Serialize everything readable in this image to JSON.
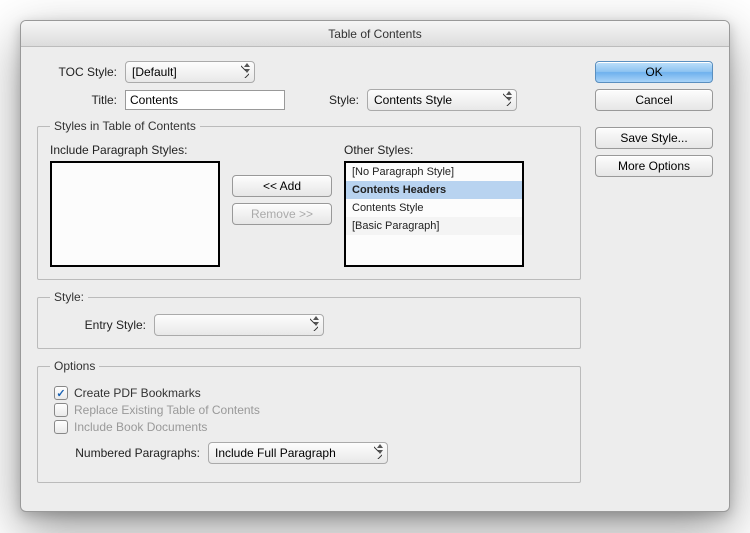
{
  "titlebar": "Table of Contents",
  "labels": {
    "toc_style": "TOC Style:",
    "title": "Title:",
    "style": "Style:",
    "include_ps": "Include Paragraph Styles:",
    "other_styles": "Other Styles:",
    "entry_style": "Entry Style:",
    "numbered_paragraphs": "Numbered Paragraphs:"
  },
  "groups": {
    "styles_in_toc": "Styles in Table of Contents",
    "style": "Style:",
    "options": "Options"
  },
  "fields": {
    "toc_style": "[Default]",
    "title_value": "Contents",
    "style_select": "Contents Style",
    "entry_style": "",
    "numbered_paragraphs": "Include Full Paragraph"
  },
  "other_styles_list": [
    "[No Paragraph Style]",
    "Contents Headers",
    "Contents Style",
    "[Basic Paragraph]"
  ],
  "other_styles_selected_index": 1,
  "buttons": {
    "add": "<< Add",
    "remove": "Remove >>",
    "ok": "OK",
    "cancel": "Cancel",
    "save_style": "Save Style...",
    "more_options": "More Options"
  },
  "checkboxes": {
    "create_pdf": {
      "label": "Create PDF Bookmarks",
      "checked": true
    },
    "replace_existing": {
      "label": "Replace Existing Table of Contents",
      "checked": false
    },
    "include_book": {
      "label": "Include Book Documents",
      "checked": false
    }
  }
}
